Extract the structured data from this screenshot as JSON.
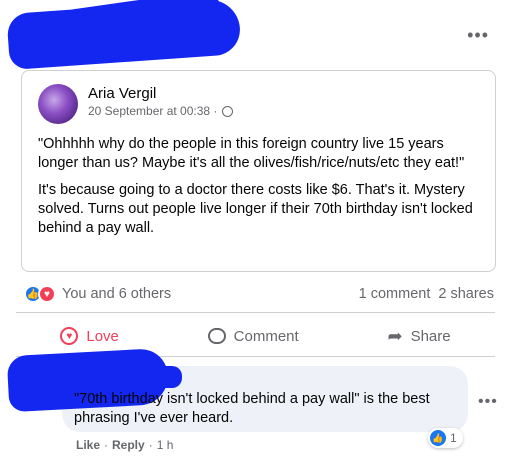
{
  "post": {
    "more_label": "•••",
    "shared": {
      "author": "Aria Vergil",
      "date": "20 September at 00:38 ·",
      "paragraphs": [
        "\"Ohhhhh why do the people in this foreign country live 15 years longer than us? Maybe it's all the olives/fish/rice/nuts/etc they eat!\"",
        "It's because going to a doctor there costs like $6. That's it. Mystery solved. Turns out people live longer if their 70th birthday isn't locked behind a pay wall."
      ]
    },
    "reactions_text": "You and 6 others",
    "comments_count": "1 comment",
    "shares_count": "2 shares",
    "actions": {
      "love": "Love",
      "comment": "Comment",
      "share": "Share"
    }
  },
  "comment": {
    "text": "\"70th birthday isn't locked behind a pay wall\" is the best phrasing I've ever heard.",
    "like_label": "Like",
    "reply_label": "Reply",
    "sep": "·",
    "time": "1 h",
    "reaction_count": "1",
    "more_label": "•••"
  },
  "colors": {
    "redaction": "#1427f0",
    "like": "#1877f2",
    "love": "#f33e58"
  },
  "icons": [
    "globe-icon",
    "like-reaction-icon",
    "love-reaction-icon",
    "comment-icon",
    "share-icon",
    "more-icon"
  ]
}
